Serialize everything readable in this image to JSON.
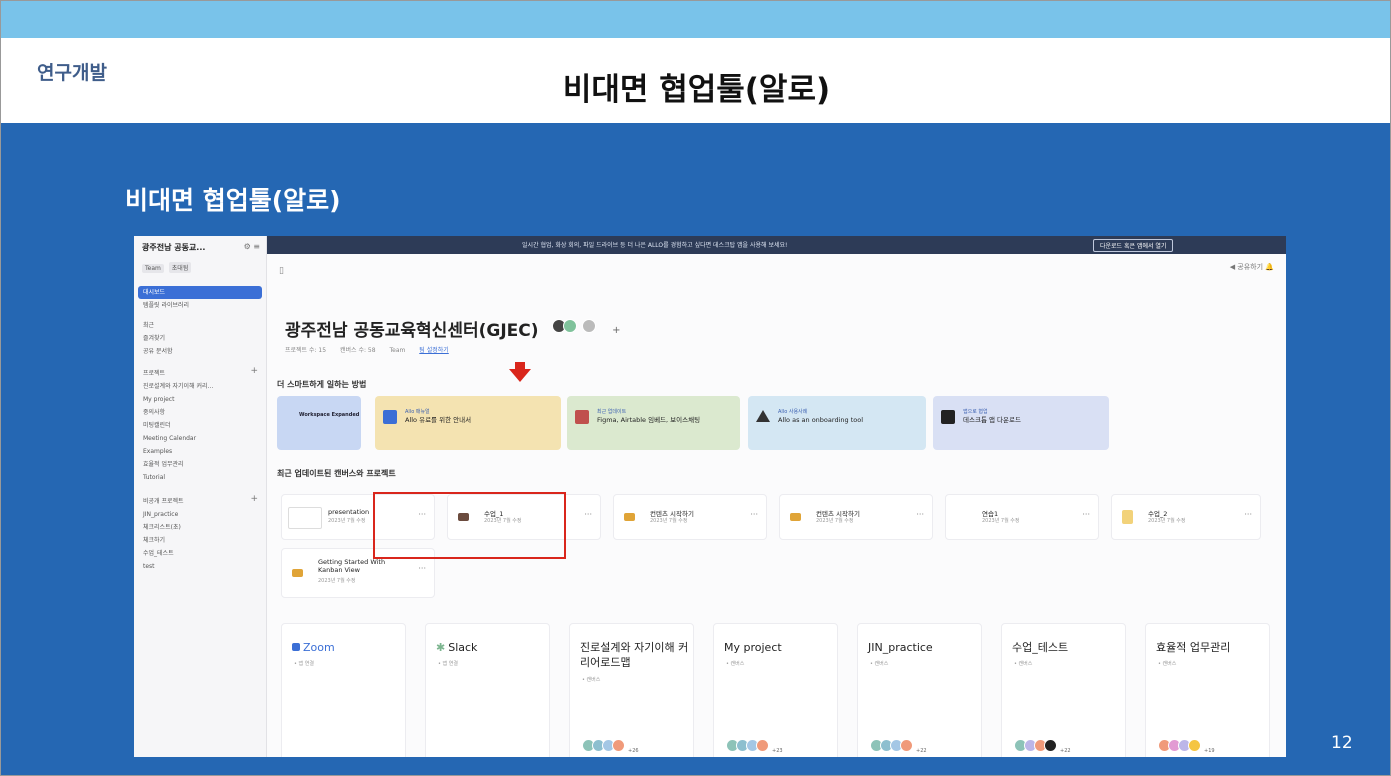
{
  "slide": {
    "section_label": "연구개발",
    "title": "비대면 협업툴(알로)",
    "subtitle": "비대면 협업툴(알로)",
    "page_number": "12"
  },
  "colors": {
    "top_bar": "#79c3ea",
    "body_bg": "#2567b3",
    "highlight": "#d9261c",
    "active_nav": "#3b6fd6"
  },
  "app": {
    "sidebar": {
      "workspace_name": "광주전남 공동교...",
      "workspace_icons": "⚙ ≡",
      "badges": [
        "Team",
        "초대됨"
      ],
      "items": [
        {
          "label": "대시보드",
          "active": true
        },
        {
          "label": "템플릿 라이브러리"
        },
        {
          "label": "최근"
        },
        {
          "label": "즐겨찾기"
        },
        {
          "label": "공유 문서함"
        },
        {
          "label": "프로젝트"
        },
        {
          "label": "진로설계와 자기이해 커리..."
        },
        {
          "label": "My project"
        },
        {
          "label": "중의사항"
        },
        {
          "label": "미팅캘린더"
        },
        {
          "label": "Meeting Calendar"
        },
        {
          "label": "Examples"
        },
        {
          "label": "효율적 업무관리"
        },
        {
          "label": "Tutorial"
        },
        {
          "label": "비공개 프로젝트"
        },
        {
          "label": "JIN_practice"
        },
        {
          "label": "체크리스트(초)"
        },
        {
          "label": "체크하기"
        },
        {
          "label": "수업_테스트"
        },
        {
          "label": "test"
        }
      ]
    },
    "top_strip": {
      "text": "일시간 협업, 화상 회의, 파일 드라이브 등 더 나은 ALLO를 경험하고 싶다면 데스크탑 앱을 사용해 보세요!",
      "button": "다운로드 혹은 앱에서 열기"
    },
    "toolbar": {
      "left_icon": "sidebar-toggle",
      "right": "◀ 공유하기    🔔"
    },
    "workspace": {
      "title": "광주전남 공동교육혁신센터(GJEC)",
      "meta": [
        "프로젝트 수: 15",
        "캔버스 수: 58",
        "Team",
        "팀 설정하기"
      ]
    },
    "sections": {
      "smart": "더 스마트하게 일하는 방법",
      "recent": "최근 업데이트된 캔버스와 프로젝트"
    },
    "promos": [
      {
        "small": "Workspace Expanded",
        "text": "",
        "color": "#c8d7f3",
        "icon_color": "#5b7fc8"
      },
      {
        "small": "Allo 매뉴얼",
        "text": "Allo 유료를 위한 안내서",
        "color": "#f4e3b1",
        "icon_color": "#3b6fd6"
      },
      {
        "small": "최근 업데이트",
        "text": "Figma, Airtable 임베드, 보이스채팅",
        "color": "#dbe9cf",
        "icon_color": "#c0504d"
      },
      {
        "small": "Allo 사용사례",
        "text": "Allo as an onboarding tool",
        "color": "#d4e7f3",
        "icon_color": "#333333"
      },
      {
        "small": "앱으로 협업",
        "text": "데스크톱 앱 다운로드",
        "color": "#d9e0f4",
        "icon_color": "#222222"
      }
    ],
    "recent": [
      {
        "title": "presentation",
        "sub": "2023년 7월 수정",
        "icon_color": "#dddddd"
      },
      {
        "title": "수업_1",
        "sub": "2023년 7월 수정",
        "icon_color": "#6b4b3e"
      },
      {
        "title": "컨텐츠 시작하기",
        "sub": "2023년 7월 수정",
        "icon_color": "#e0a437"
      },
      {
        "title": "컨텐츠 시작하기",
        "sub": "2023년 7월 수정",
        "icon_color": "#e0a437"
      },
      {
        "title": "연습1",
        "sub": "2023년 7월 수정",
        "icon_color": "#ffffff"
      },
      {
        "title": "수업_2",
        "sub": "2023년 7월 수정",
        "icon_color": "#f2d27a"
      }
    ],
    "recent_extra": {
      "title": "Getting Started With Kanban View",
      "sub": "2023년 7월 수정",
      "icon_color": "#e0a437"
    },
    "projects": [
      {
        "title": "Zoom",
        "sub": "• 앱 연결",
        "avatars": [
          "#cfd8e8"
        ],
        "count": ""
      },
      {
        "title": "Slack",
        "sub": "• 앱 연결",
        "avatars": [
          "#d8d8d8"
        ],
        "count": ""
      },
      {
        "title": "진로설계와 자기이해 커리어로드맵",
        "sub": "• 캔버스",
        "avatars": [
          "#8dc3b8",
          "#8dbfcf",
          "#a4c7e5",
          "#f09a7a"
        ],
        "count": "+26"
      },
      {
        "title": "My project",
        "sub": "• 캔버스",
        "avatars": [
          "#8dc3b8",
          "#8dbfcf",
          "#a4c7e5",
          "#f09a7a"
        ],
        "count": "+23"
      },
      {
        "title": "JIN_practice",
        "sub": "• 캔버스",
        "avatars": [
          "#8dc3b8",
          "#8dbfcf",
          "#a4c7e5",
          "#f09a7a"
        ],
        "count": "+22"
      },
      {
        "title": "수업_테스트",
        "sub": "• 캔버스",
        "avatars": [
          "#8dc3b8",
          "#bcb6e8",
          "#f09a7a",
          "#222222"
        ],
        "count": "+22"
      },
      {
        "title": "효율적 업무관리",
        "sub": "• 캔버스",
        "avatars": [
          "#f09a7a",
          "#e29ad3",
          "#bcb6e8",
          "#f5c542"
        ],
        "count": "+19"
      }
    ]
  }
}
